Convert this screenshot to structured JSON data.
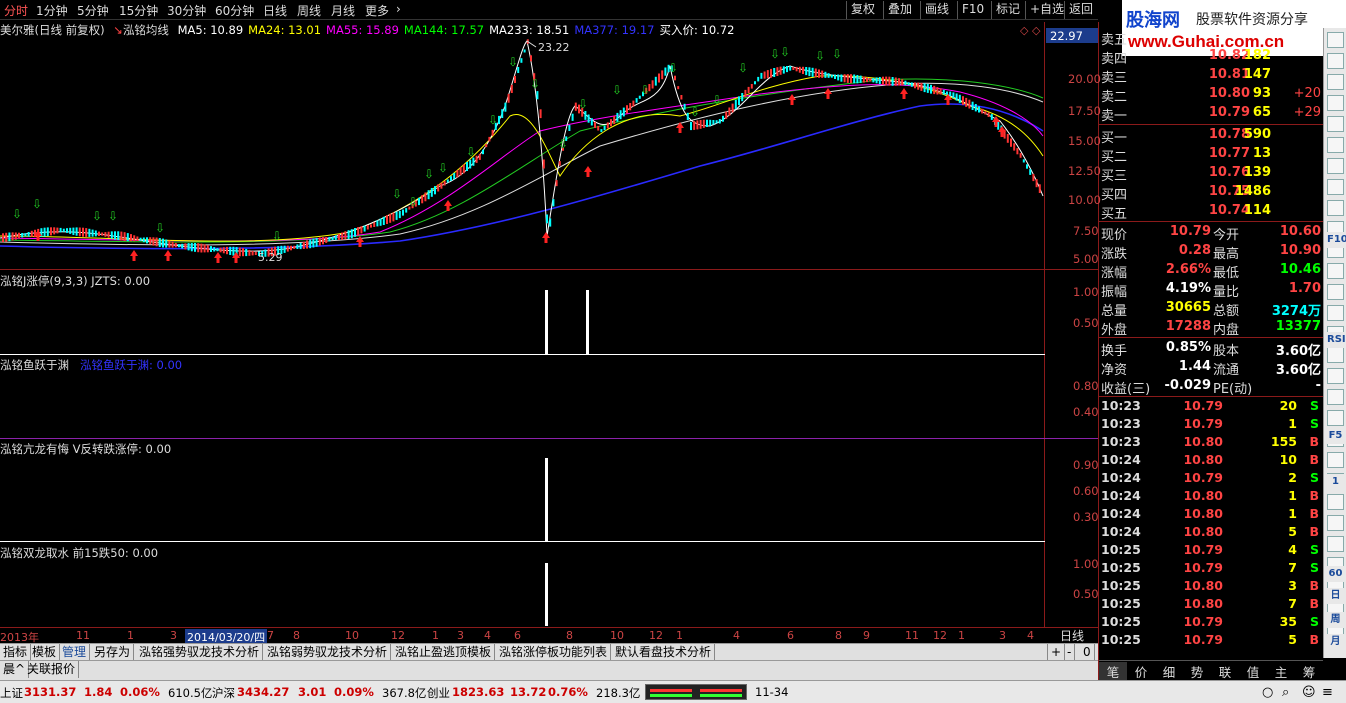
{
  "topbar": {
    "periods": [
      "分时",
      "1分钟",
      "5分钟",
      "15分钟",
      "30分钟",
      "60分钟",
      "日线",
      "周线",
      "月线",
      "更多"
    ],
    "right_buttons": [
      "复权",
      "叠加",
      "画线",
      "F10",
      "标记",
      "+自选",
      "返回"
    ]
  },
  "main_chart": {
    "stock_name": "美尔雅(日线 前复权)",
    "indicator_name": "泓铭均线",
    "ma": [
      {
        "label": "MA5: 10.89",
        "color": "#ffffff"
      },
      {
        "label": "MA24: 13.01",
        "color": "#ffff00"
      },
      {
        "label": "MA55: 15.89",
        "color": "#ff00ff"
      },
      {
        "label": "MA144: 17.57",
        "color": "#00ff00"
      },
      {
        "label": "MA233: 18.51",
        "color": "#ffffff"
      },
      {
        "label": "MA377: 19.17",
        "color": "#3333ff"
      },
      {
        "label": "买入价: 10.72",
        "color": "#ffffff"
      }
    ],
    "price_axis": [
      "22.97",
      "20.00",
      "17.50",
      "15.00",
      "12.50",
      "10.00",
      "7.50",
      "5.00"
    ],
    "high_label": "23.22",
    "low_label": "5.29"
  },
  "sub1": {
    "title": "泓铭J涨停(9,3,3) JZTS: 0.00",
    "axis": [
      "1.00",
      "0.50"
    ]
  },
  "sub2": {
    "title": "泓铭鱼跃于渊",
    "value": "泓铭鱼跃于渊: 0.00",
    "axis": [
      "0.80",
      "0.40"
    ]
  },
  "sub3": {
    "title": "泓铭亢龙有悔  V反转跌涨停: 0.00",
    "axis": [
      "0.90",
      "0.60",
      "0.30"
    ]
  },
  "sub4": {
    "title": "泓铭双龙取水  前15跌50: 0.00",
    "axis": [
      "1.00",
      "0.50"
    ]
  },
  "date_axis": {
    "labels": [
      "2013年",
      "11",
      "1",
      "3",
      "2014/03/20/四",
      "7",
      "8",
      "10",
      "12",
      "1",
      "3",
      "4",
      "6",
      "8",
      "10",
      "12",
      "1",
      "4",
      "6",
      "8",
      "9",
      "11",
      "12",
      "1",
      "3",
      "4"
    ],
    "period": "日线"
  },
  "bottom_tabs": [
    "指标",
    "模板",
    "管理",
    "另存为",
    "泓铭强势驭龙技术分析",
    "泓铭弱势驭龙技术分析",
    "泓铭止盈逃顶模板",
    "泓铭涨停板功能列表",
    "默认看盘技术分析"
  ],
  "bottom_left2": [
    "晨^",
    "关联报价"
  ],
  "logo": {
    "title": "股海网",
    "slogan": "股票软件资源分享",
    "url": "www.Guhai.com.cn"
  },
  "order_book": {
    "asks": [
      {
        "label": "卖五",
        "price": "",
        "vol": "",
        "chg": ""
      },
      {
        "label": "卖四",
        "price": "10.82",
        "vol": "182",
        "chg": ""
      },
      {
        "label": "卖三",
        "price": "10.81",
        "vol": "147",
        "chg": ""
      },
      {
        "label": "卖二",
        "price": "10.80",
        "vol": "93",
        "chg": "+20"
      },
      {
        "label": "卖一",
        "price": "10.79",
        "vol": "65",
        "chg": "+29"
      }
    ],
    "bids": [
      {
        "label": "买一",
        "price": "10.78",
        "vol": "590"
      },
      {
        "label": "买二",
        "price": "10.77",
        "vol": "13"
      },
      {
        "label": "买三",
        "price": "10.76",
        "vol": "139"
      },
      {
        "label": "买四",
        "price": "10.75",
        "vol": "1486"
      },
      {
        "label": "买五",
        "price": "10.74",
        "vol": "114"
      }
    ]
  },
  "stats": [
    {
      "l1": "现价",
      "v1": "10.79",
      "c1": "#ff4444",
      "l2": "今开",
      "v2": "10.60",
      "c2": "#ff4444"
    },
    {
      "l1": "涨跌",
      "v1": "0.28",
      "c1": "#ff4444",
      "l2": "最高",
      "v2": "10.90",
      "c2": "#ff4444"
    },
    {
      "l1": "涨幅",
      "v1": "2.66%",
      "c1": "#ff4444",
      "l2": "最低",
      "v2": "10.46",
      "c2": "#00ff00"
    },
    {
      "l1": "振幅",
      "v1": "4.19%",
      "c1": "#ffffff",
      "l2": "量比",
      "v2": "1.70",
      "c2": "#ff4444"
    },
    {
      "l1": "总量",
      "v1": "30665",
      "c1": "#ffff00",
      "l2": "总额",
      "v2": "3274万",
      "c2": "#00ffff"
    },
    {
      "l1": "外盘",
      "v1": "17288",
      "c1": "#ff4444",
      "l2": "内盘",
      "v2": "13377",
      "c2": "#00ff00"
    },
    {
      "l1": "换手",
      "v1": "0.85%",
      "c1": "#ffffff",
      "l2": "股本",
      "v2": "3.60亿",
      "c2": "#ffffff"
    },
    {
      "l1": "净资",
      "v1": "1.44",
      "c1": "#ffffff",
      "l2": "流通",
      "v2": "3.60亿",
      "c2": "#ffffff"
    },
    {
      "l1": "收益(三)",
      "v1": "-0.029",
      "c1": "#ffffff",
      "l2": "PE(动)",
      "v2": "-",
      "c2": "#ffffff"
    }
  ],
  "ticks": [
    {
      "t": "10:23",
      "p": "10.79",
      "v": "20",
      "s": "S"
    },
    {
      "t": "10:23",
      "p": "10.79",
      "v": "1",
      "s": "S"
    },
    {
      "t": "10:23",
      "p": "10.80",
      "v": "155",
      "s": "B"
    },
    {
      "t": "10:24",
      "p": "10.80",
      "v": "10",
      "s": "B"
    },
    {
      "t": "10:24",
      "p": "10.79",
      "v": "2",
      "s": "S"
    },
    {
      "t": "10:24",
      "p": "10.80",
      "v": "1",
      "s": "B"
    },
    {
      "t": "10:24",
      "p": "10.80",
      "v": "1",
      "s": "B"
    },
    {
      "t": "10:24",
      "p": "10.80",
      "v": "5",
      "s": "B"
    },
    {
      "t": "10:25",
      "p": "10.79",
      "v": "4",
      "s": "S"
    },
    {
      "t": "10:25",
      "p": "10.79",
      "v": "7",
      "s": "S"
    },
    {
      "t": "10:25",
      "p": "10.80",
      "v": "3",
      "s": "B"
    },
    {
      "t": "10:25",
      "p": "10.80",
      "v": "7",
      "s": "B"
    },
    {
      "t": "10:25",
      "p": "10.79",
      "v": "35",
      "s": "S"
    },
    {
      "t": "10:25",
      "p": "10.79",
      "v": "5",
      "s": "B"
    }
  ],
  "right_tabs": [
    "笔",
    "价",
    "细",
    "势",
    "联",
    "值",
    "主",
    "筹"
  ],
  "sidebar_labels": [
    "F10",
    "RSI",
    "F5",
    "1",
    "60",
    "日",
    "周",
    "月"
  ],
  "status": {
    "sh_label": "上证",
    "sh_val": "3131.37",
    "sh_chg": "1.84",
    "sh_pct": "0.06%",
    "sh_amt": "610.5亿",
    "hs_label": "沪深",
    "hs_val": "3434.27",
    "hs_chg": "3.01",
    "hs_pct": "0.09%",
    "hs_amt": "367.8亿",
    "cy_label": "创业",
    "cy_val": "1823.63",
    "cy_chg": "13.72",
    "cy_pct": "0.76%",
    "cy_amt": "218.3亿",
    "range": "11-34"
  }
}
